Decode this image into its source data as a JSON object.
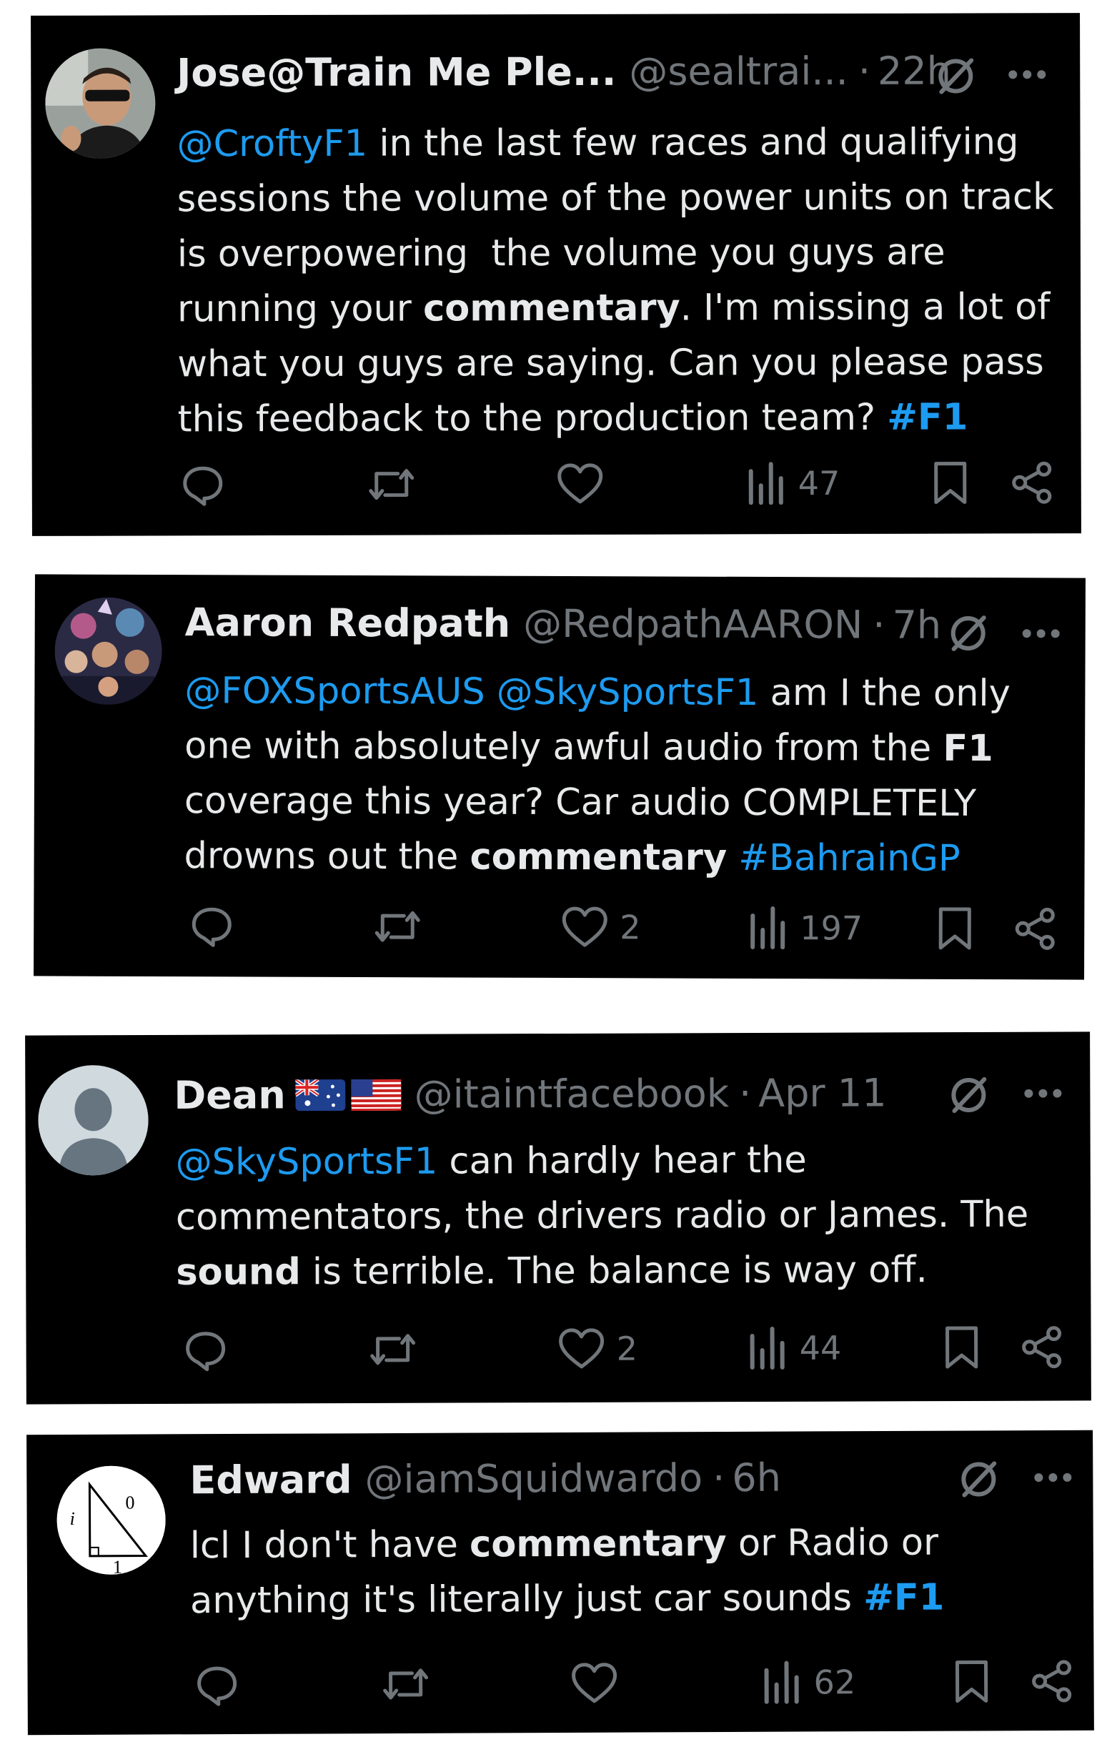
{
  "tweets": [
    {
      "name": "Jose@Train Me Ple...",
      "handle": "@sealtrai...",
      "time": "22h",
      "lines": [
        [
          {
            "t": "@CroftyF1",
            "k": "mention"
          },
          {
            "t": " in the last few races and qualifying",
            "k": "text"
          }
        ],
        [
          {
            "t": "sessions the volume of the power units on track",
            "k": "text"
          }
        ],
        [
          {
            "t": "is overpowering  the volume you guys are",
            "k": "text"
          }
        ],
        [
          {
            "t": "running your ",
            "k": "text"
          },
          {
            "t": "commentary",
            "k": "bold"
          },
          {
            "t": ". I'm missing a lot of",
            "k": "text"
          }
        ],
        [
          {
            "t": "what you guys are saying. Can you please pass",
            "k": "text"
          }
        ],
        [
          {
            "t": "this feedback to the production team? ",
            "k": "text"
          },
          {
            "t": "#F1",
            "k": "tagbold"
          }
        ]
      ],
      "likes": "",
      "views": "47",
      "avatar_icon": "profile-photo-sunglasses"
    },
    {
      "name": "Aaron Redpath",
      "handle": "@RedpathAARON",
      "time": "7h",
      "lines": [
        [
          {
            "t": "@FOXSportsAUS",
            "k": "mention"
          },
          {
            "t": " ",
            "k": "text"
          },
          {
            "t": "@SkySportsF1",
            "k": "mention"
          },
          {
            "t": " am I the only",
            "k": "text"
          }
        ],
        [
          {
            "t": "one with absolutely awful audio from the ",
            "k": "text"
          },
          {
            "t": "F1",
            "k": "bold"
          }
        ],
        [
          {
            "t": "coverage this year? Car audio COMPLETELY",
            "k": "text"
          }
        ],
        [
          {
            "t": "drowns out the ",
            "k": "text"
          },
          {
            "t": "commentary",
            "k": "bold"
          },
          {
            "t": " ",
            "k": "text"
          },
          {
            "t": "#BahrainGP",
            "k": "tag"
          }
        ]
      ],
      "likes": "2",
      "views": "197",
      "avatar_icon": "profile-photo-crowd"
    },
    {
      "name": "Dean",
      "handle": "@itaintfacebook",
      "time": "Apr 11",
      "flags": [
        "australia-flag-icon",
        "usa-flag-icon"
      ],
      "lines": [
        [
          {
            "t": "@SkySportsF1",
            "k": "mention"
          },
          {
            "t": " can hardly hear the",
            "k": "text"
          }
        ],
        [
          {
            "t": "commentators, the drivers radio or James. The",
            "k": "text"
          }
        ],
        [
          {
            "t": "sound",
            "k": "bold"
          },
          {
            "t": " is terrible. The balance is way off.",
            "k": "text"
          }
        ]
      ],
      "likes": "2",
      "views": "44",
      "avatar_icon": "default-profile-icon"
    },
    {
      "name": "Edward",
      "handle": "@iamSquidwardo",
      "time": "6h",
      "lines": [
        [
          {
            "t": "lcl I don't have ",
            "k": "text"
          },
          {
            "t": "commentary",
            "k": "bold"
          },
          {
            "t": " or Radio or",
            "k": "text"
          }
        ],
        [
          {
            "t": "anything it's literally just car sounds ",
            "k": "text"
          },
          {
            "t": "#F1",
            "k": "tagbold"
          }
        ]
      ],
      "likes": "",
      "views": "62",
      "avatar_icon": "triangle-diagram-avatar",
      "avatar_labels": {
        "top": "0",
        "left": "i",
        "bottom": "1"
      }
    }
  ],
  "colors": {
    "background": "#000000",
    "text": "#e7e9ea",
    "muted": "#71767b",
    "link": "#1d9bf0",
    "page": "#ffffff"
  },
  "icons": [
    "reply-icon",
    "retweet-icon",
    "like-icon",
    "views-icon",
    "bookmark-icon",
    "share-icon",
    "grok-icon",
    "more-icon"
  ]
}
